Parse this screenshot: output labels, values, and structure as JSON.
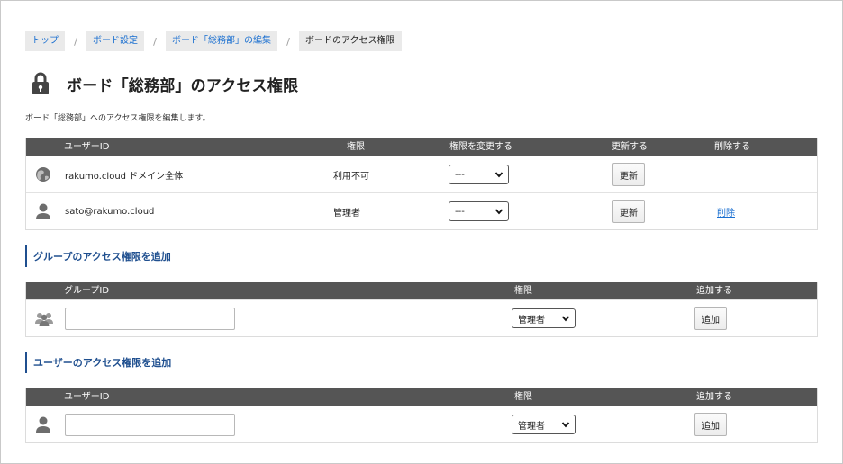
{
  "breadcrumb": [
    {
      "label": "トップ"
    },
    {
      "label": "ボード設定"
    },
    {
      "label": "ボード「総務部」の編集"
    },
    {
      "label": "ボードのアクセス権限"
    }
  ],
  "breadcrumb_separator": "/",
  "page": {
    "title": "ボード「総務部」のアクセス権限",
    "description": "ボード「総務部」へのアクセス権限を編集します。",
    "icon": "lock-icon"
  },
  "permissions_table": {
    "headers": {
      "user_id": "ユーザーID",
      "permission": "権限",
      "change": "権限を変更する",
      "update": "更新する",
      "delete": "削除する"
    },
    "rows": [
      {
        "icon": "globe-icon",
        "user_id": "rakumo.cloud ドメイン全体",
        "permission": "利用不可",
        "select_value": "---",
        "update_label": "更新",
        "delete_label": ""
      },
      {
        "icon": "user-icon",
        "user_id": "sato@rakumo.cloud",
        "permission": "管理者",
        "select_value": "---",
        "update_label": "更新",
        "delete_label": "削除"
      }
    ]
  },
  "group_section": {
    "heading": "グループのアクセス権限を追加",
    "headers": {
      "group_id": "グループID",
      "permission": "権限",
      "add": "追加する"
    },
    "row": {
      "icon": "group-icon",
      "input_value": "",
      "select_value": "管理者",
      "add_label": "追加"
    }
  },
  "user_section": {
    "heading": "ユーザーのアクセス権限を追加",
    "headers": {
      "user_id": "ユーザーID",
      "permission": "権限",
      "add": "追加する"
    },
    "row": {
      "icon": "user-icon",
      "input_value": "",
      "select_value": "管理者",
      "add_label": "追加"
    }
  },
  "colors": {
    "link": "#1a6fd0",
    "table_header": "#555555",
    "section_accent": "#1f4f8f"
  }
}
